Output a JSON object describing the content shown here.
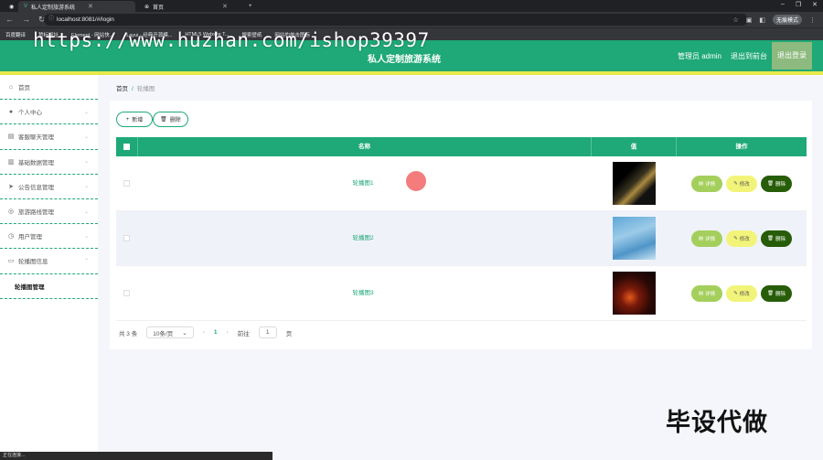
{
  "browser": {
    "tabs": [
      {
        "title": "私人定制旅游系统",
        "active": true
      },
      {
        "title": "首页",
        "active": false
      }
    ],
    "url": "localhost:8081/#/login",
    "incognito_label": "无痕模式",
    "bookmarks": [
      "百度翻译",
      "赞标网址",
      "Element - 网站快...",
      "Layui - 经典开源模...",
      "HTML5 Website T...",
      "搜索壁纸",
      "网站的单击图标"
    ],
    "status_text": "正在连接..."
  },
  "watermark": "https://www.huzhan.com/ishop39397",
  "header": {
    "title": "私人定制旅游系统",
    "admin_label": "管理员 admin",
    "back_label": "退出到前台",
    "logout_label": "退出登录"
  },
  "sidebar": {
    "items": [
      {
        "label": "首页",
        "icon": "home-icon"
      },
      {
        "label": "个人中心",
        "icon": "user-icon"
      },
      {
        "label": "客服聊天管理",
        "icon": "chat-icon"
      },
      {
        "label": "基础数据管理",
        "icon": "store-icon"
      },
      {
        "label": "公告信息管理",
        "icon": "send-icon"
      },
      {
        "label": "旅游路线管理",
        "icon": "compass-icon"
      },
      {
        "label": "用户管理",
        "icon": "clock-icon"
      },
      {
        "label": "轮播图信息",
        "icon": "message-icon"
      }
    ],
    "sub_item": "轮播图管理"
  },
  "breadcrumb": {
    "home": "首页",
    "current": "轮播图"
  },
  "toolbar": {
    "add_label": "新增",
    "delete_label": "删除"
  },
  "table": {
    "headers": {
      "name": "名称",
      "value": "值",
      "ops": "操作"
    },
    "rows": [
      {
        "name": "轮播图1"
      },
      {
        "name": "轮播图2"
      },
      {
        "name": "轮播图3"
      }
    ],
    "ops": {
      "detail": "详情",
      "edit": "修改",
      "delete": "删除"
    }
  },
  "pagination": {
    "total": "共 3 条",
    "page_size": "10条/页",
    "current_page": "1",
    "goto_label": "前往",
    "goto_value": "1",
    "page_unit": "页"
  },
  "corner_text": "毕设代做",
  "colors": {
    "primary": "#1fa878",
    "accent": "#e7e84b",
    "detail": "#a4cf5c",
    "edit": "#f2f47a",
    "delete": "#275d09"
  }
}
